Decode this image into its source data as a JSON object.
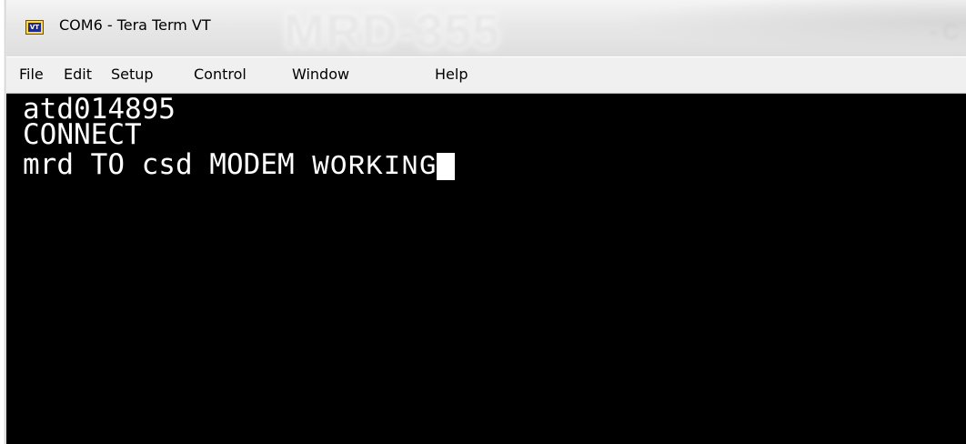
{
  "window": {
    "title": "COM6 - Tera Term VT",
    "icon_label": "VT",
    "icon": "tera-term-vt-icon",
    "background_watermark": "MRD-355",
    "background_right_smudge": "- C"
  },
  "menubar": {
    "items": [
      {
        "label": "File"
      },
      {
        "label": "Edit"
      },
      {
        "label": "Setup"
      },
      {
        "label": "Control"
      },
      {
        "label": "Window"
      },
      {
        "label": "Help"
      }
    ]
  },
  "terminal": {
    "lines": [
      "atd014895",
      "CONNECT",
      "mrd TO csd MODEM"
    ],
    "line3_tail": "WORKING",
    "colors": {
      "background": "#000000",
      "foreground": "#ffffff"
    }
  }
}
